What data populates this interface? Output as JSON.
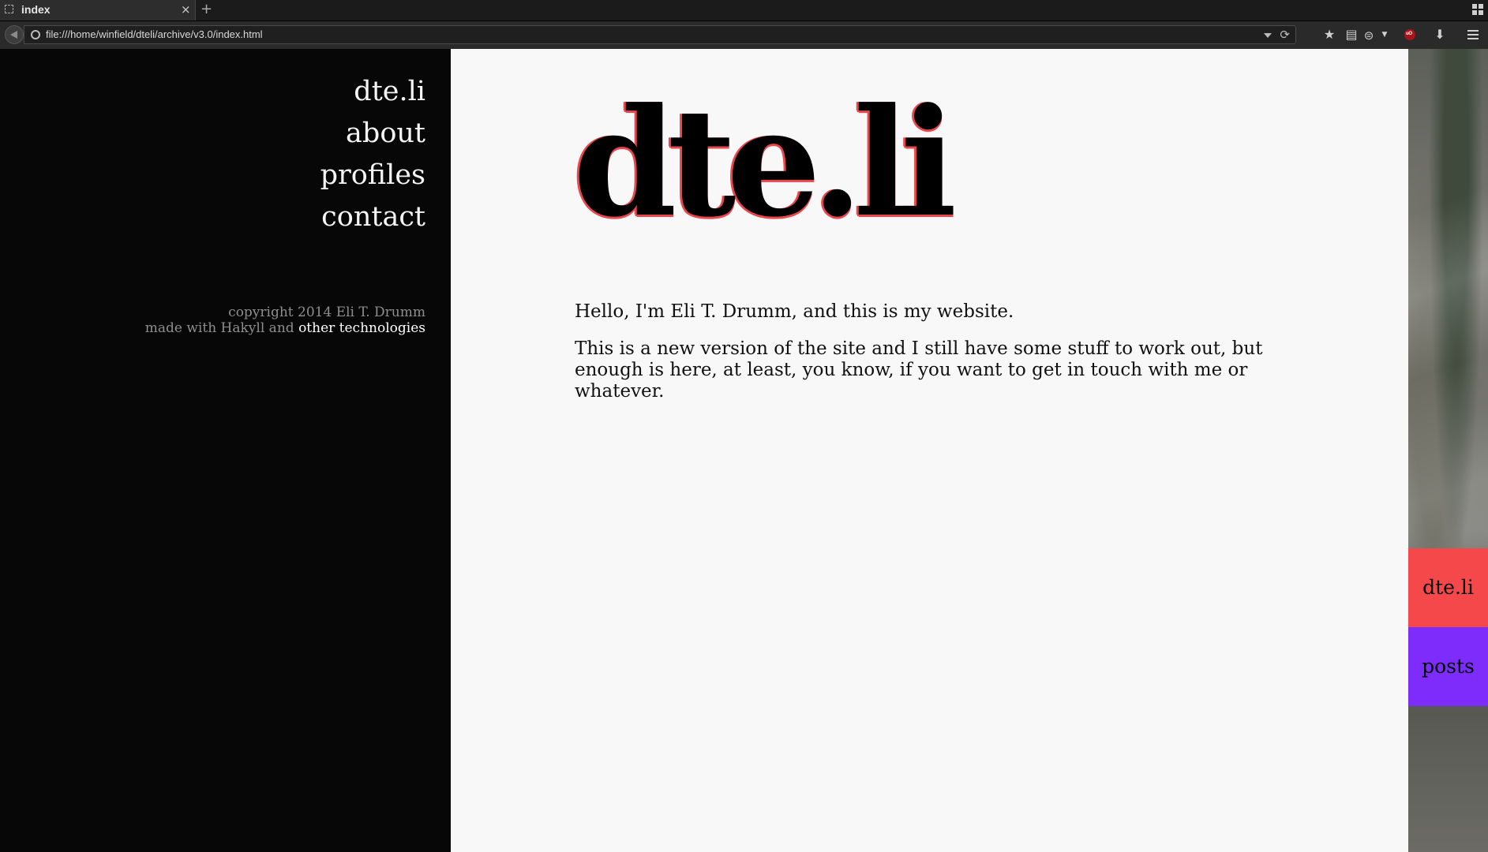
{
  "browser": {
    "tab_title": "index",
    "tab_close": "×",
    "new_tab": "+",
    "url": "file:///home/winfield/dteli/archive/v3.0/index.html",
    "reload": "⟳",
    "ublock_badge": "uO",
    "toolbar_icons": [
      "bookmark-star-icon",
      "reader-view-icon",
      "privacy-mask-icon",
      "dropdown-icon",
      "ublock-icon",
      "download-icon",
      "hamburger-menu-icon"
    ]
  },
  "sidebar": {
    "nav": [
      "dte.li",
      "about",
      "profiles",
      "contact"
    ],
    "copyright": "copyright 2014 Eli T. Drumm",
    "made_with_prefix": "made with Hakyll and",
    "made_with_link": "other technologies"
  },
  "main": {
    "hero": "dte.li",
    "intro": "Hello, I'm Eli T. Drumm, and this is my website.",
    "body": "This is a new version of the site and I still have some stuff to work out, but enough is here, at least, you know, if you want to get in touch with me or whatever."
  },
  "quicklinks": [
    {
      "label": "dte.li",
      "color": "#f5484b"
    },
    {
      "label": "posts",
      "color": "#7d2cfc"
    }
  ],
  "colors": {
    "sidebar_bg": "#070707",
    "content_bg": "#f8f8f8",
    "hero_outline": "#e9464d"
  }
}
